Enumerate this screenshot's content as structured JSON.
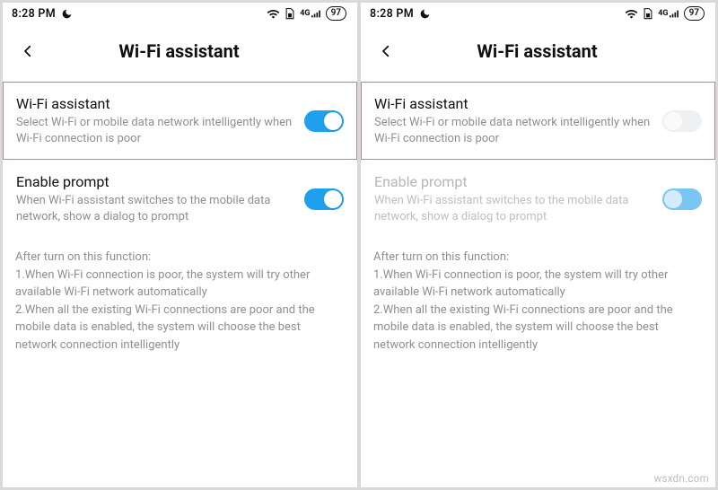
{
  "statusbar": {
    "time": "8:28 PM",
    "network_label": "4G",
    "battery": "97"
  },
  "header": {
    "title": "Wi-Fi assistant"
  },
  "wifi_assistant": {
    "label": "Wi-Fi assistant",
    "desc": "Select Wi-Fi or mobile data network intelligently when Wi-Fi connection is poor"
  },
  "enable_prompt": {
    "label": "Enable prompt",
    "desc": "When Wi-Fi assistant switches to the mobile data network, show a dialog to prompt"
  },
  "info": {
    "heading": "After turn on this function:",
    "line1": "1.When Wi-Fi connection is poor, the system will try other available Wi-Fi network automatically",
    "line2": "2.When all the existing Wi-Fi connections are poor and the mobile data is enabled, the system will choose the best network connection intelligently"
  },
  "watermark": "wsxdn.com"
}
